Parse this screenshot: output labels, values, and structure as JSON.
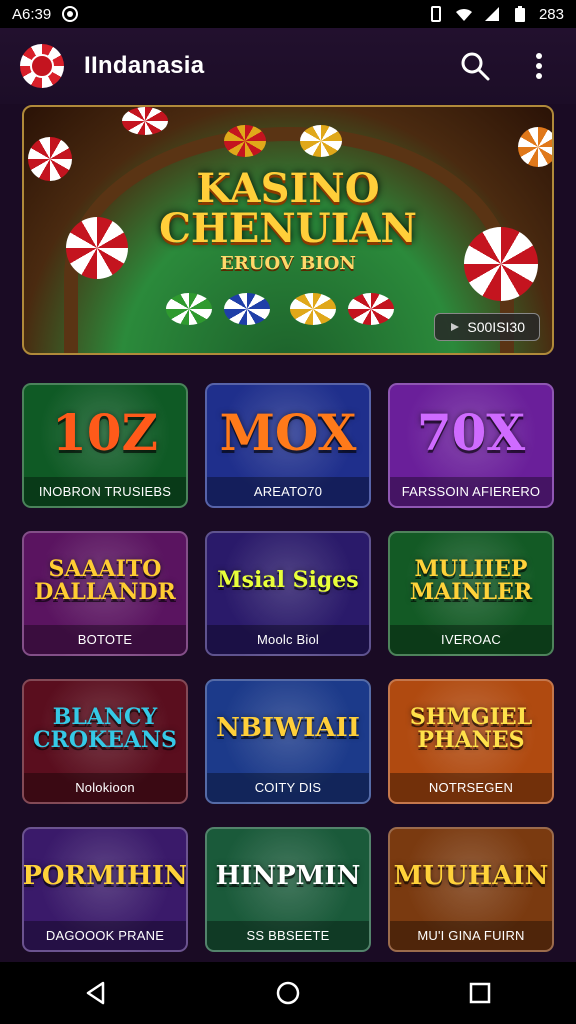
{
  "status": {
    "time": "A6:39",
    "battery": "283"
  },
  "appbar": {
    "title": "IIndanasia"
  },
  "banner": {
    "title_line1": "KASINO",
    "title_line2": "CHENUIAN",
    "subtitle": "ERUOV BION",
    "button": "S00ISI30"
  },
  "games": [
    {
      "title": "10Z",
      "label": "INOBRON TRUSIEBS",
      "bg": "#0f5a25",
      "text": "#ff5a1a"
    },
    {
      "title": "MOX",
      "label": "AREATO70",
      "bg": "#1f2f8c",
      "text": "#ff7a1a"
    },
    {
      "title": "70X",
      "label": "FARSSOIN AFIERERO",
      "bg": "#6a1f9a",
      "text": "#cf6bff"
    },
    {
      "title": "SAAAITO DALLANDR",
      "label": "BOTOTE",
      "bg": "#5a1460",
      "text": "#ffcc33"
    },
    {
      "title": "Msial Siges",
      "label": "Moolc Biol",
      "bg": "#2a1a6a",
      "text": "#e8ff3a"
    },
    {
      "title": "MULIIEP MAINLER",
      "label": "IVEROAC",
      "bg": "#135a25",
      "text": "#ffd23a"
    },
    {
      "title": "BLANCY CROKEANS",
      "label": "Nolokioon",
      "bg": "#5a0e1e",
      "text": "#35c9e6"
    },
    {
      "title": "NBIWIAII",
      "label": "COITY DIS",
      "bg": "#1c3a8a",
      "text": "#ffcf3a"
    },
    {
      "title": "SHMGIEL PHANES",
      "label": "NOTRSEGEN",
      "bg": "#b04a10",
      "text": "#ffe14a"
    },
    {
      "title": "PORMIHIN",
      "label": "DAGOOOK PRANE",
      "bg": "#3a1a6a",
      "text": "#ffd23a"
    },
    {
      "title": "HINPMIN",
      "label": "SS BBSEETE",
      "bg": "#1a5a3a",
      "text": "#ffffff"
    },
    {
      "title": "MUUHAIN",
      "label": "MU'I GINA FUIRN",
      "bg": "#7a3a10",
      "text": "#ffd23a"
    }
  ],
  "colors": {
    "background": "#1a0b24",
    "banner_border": "#b08a3a",
    "accent": "#ffcf3a"
  },
  "icons": {
    "search": "search-icon",
    "menu": "more-vert-icon",
    "back": "back-icon",
    "home": "home-icon",
    "recents": "recents-icon"
  }
}
